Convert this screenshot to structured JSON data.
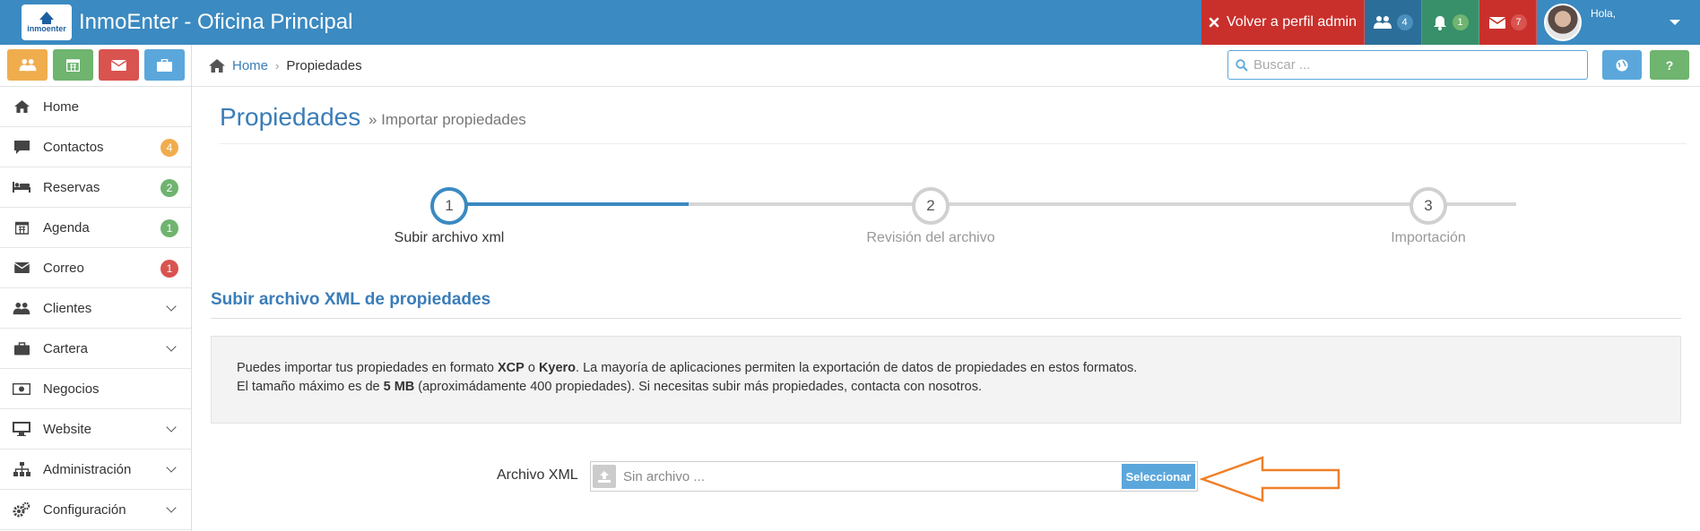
{
  "header": {
    "logo_text": "inmoenter",
    "app_title": "InmoEnter - Oficina Principal",
    "admin_button": "Volver a perfil admin",
    "users_count": "4",
    "notifications_count": "1",
    "messages_count": "7",
    "greeting": "Hola,"
  },
  "breadcrumb": {
    "home": "Home",
    "current": "Propiedades"
  },
  "search": {
    "placeholder": "Buscar ..."
  },
  "toolbar": {
    "help_label": "?"
  },
  "sidebar": {
    "items": [
      {
        "label": "Home",
        "icon": "home-icon"
      },
      {
        "label": "Contactos",
        "icon": "comment-icon",
        "badge": "4"
      },
      {
        "label": "Reservas",
        "icon": "bed-icon",
        "badge": "2"
      },
      {
        "label": "Agenda",
        "icon": "calendar-icon",
        "badge": "1"
      },
      {
        "label": "Correo",
        "icon": "envelope-icon",
        "badge": "1"
      },
      {
        "label": "Clientes",
        "icon": "users-icon"
      },
      {
        "label": "Cartera",
        "icon": "briefcase-icon"
      },
      {
        "label": "Negocios",
        "icon": "money-icon"
      },
      {
        "label": "Website",
        "icon": "desktop-icon"
      },
      {
        "label": "Administración",
        "icon": "sitemap-icon"
      },
      {
        "label": "Configuración",
        "icon": "cogs-icon"
      }
    ]
  },
  "page": {
    "title": "Propiedades",
    "subtitle": "» Importar propiedades"
  },
  "wizard": {
    "steps": [
      {
        "number": "1",
        "label": "Subir archivo xml"
      },
      {
        "number": "2",
        "label": "Revisión del archivo"
      },
      {
        "number": "3",
        "label": "Importación"
      }
    ]
  },
  "upload": {
    "section_title": "Subir archivo XML de propiedades",
    "info_line1_a": "Puedes importar tus propiedades en formato ",
    "info_xcp": "XCP",
    "info_line1_b": " o ",
    "info_kyero": "Kyero",
    "info_line1_c": ". La mayoría de aplicaciones permiten la exportación de datos de propiedades en estos formatos.",
    "info_line2_a": "El tamaño máximo es de ",
    "info_size": "5 MB",
    "info_line2_b": " (aproximádamente 400 propiedades). Si necesitas subir más propiedades, contacta con nosotros.",
    "file_label": "Archivo XML",
    "file_placeholder": "Sin archivo ...",
    "select_button": "Seleccionar"
  },
  "colors": {
    "primary": "#3b8ac1",
    "danger": "#c9302c",
    "success": "#38906a",
    "annotation_arrow": "#f07f28"
  }
}
